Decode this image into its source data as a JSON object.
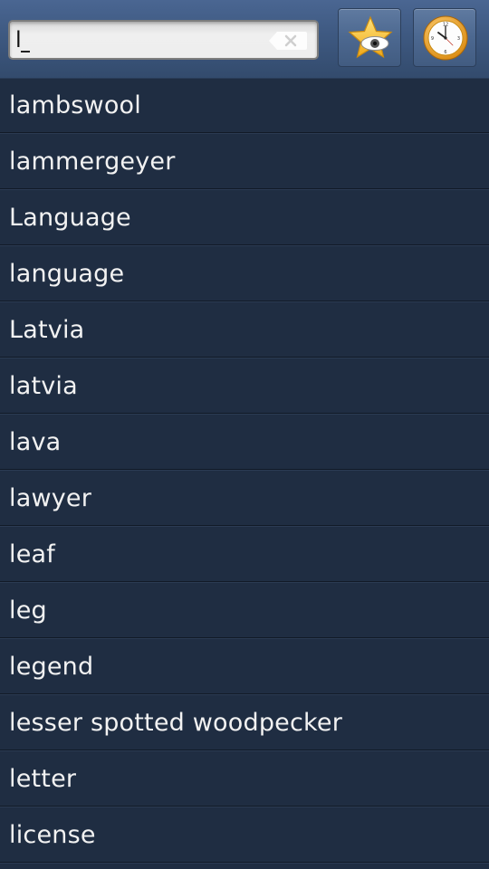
{
  "search": {
    "value": "l",
    "clear_icon": "clear-x-icon"
  },
  "toolbar": {
    "favorites_icon": "star-eye-icon",
    "history_icon": "clock-icon"
  },
  "colors": {
    "background": "#1f2d42",
    "toolbar": "#3e5981",
    "text": "#f2f2f2",
    "star": "#f5b820"
  },
  "words": [
    "lambswool",
    "lammergeyer",
    "Language",
    "language",
    "Latvia",
    "latvia",
    "lava",
    "lawyer",
    "leaf",
    "leg",
    "legend",
    "lesser spotted woodpecker",
    "letter",
    "license"
  ]
}
